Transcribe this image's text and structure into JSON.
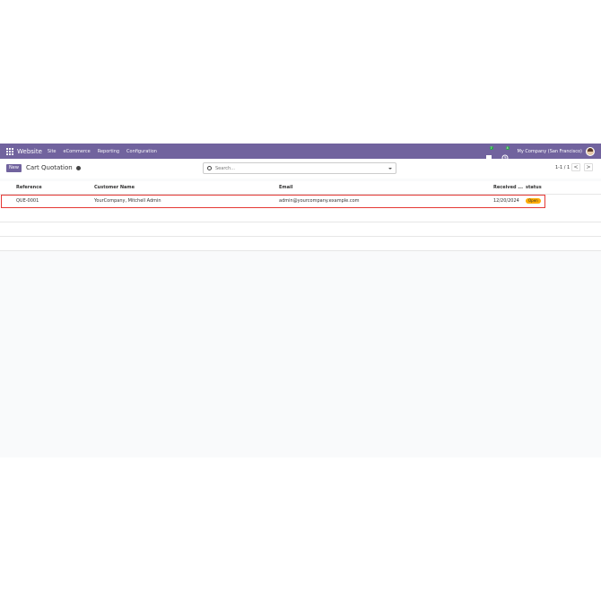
{
  "navbar": {
    "brand": "Website",
    "menu": [
      "Site",
      "eCommerce",
      "Reporting",
      "Configuration"
    ],
    "chat_badge": "7",
    "activity_badge": "4",
    "company": "My Company (San Francisco)"
  },
  "control": {
    "new_label": "New",
    "breadcrumb": "Cart Quotation",
    "search_placeholder": "Search...",
    "pager": "1-1 / 1",
    "prev": "<",
    "next": ">"
  },
  "table": {
    "headers": {
      "reference": "Reference",
      "customer": "Customer Name",
      "email": "Email",
      "received": "Received ...",
      "status": "status"
    },
    "rows": [
      {
        "reference": "QUE-0001",
        "customer": "YourCompany, Mitchell Admin",
        "email": "admin@yourcompany.example.com",
        "received": "12/20/2024",
        "status": "Open"
      }
    ]
  },
  "colors": {
    "navbar": "#71639e",
    "status_open": "#ffac00",
    "highlight": "#e53935"
  }
}
